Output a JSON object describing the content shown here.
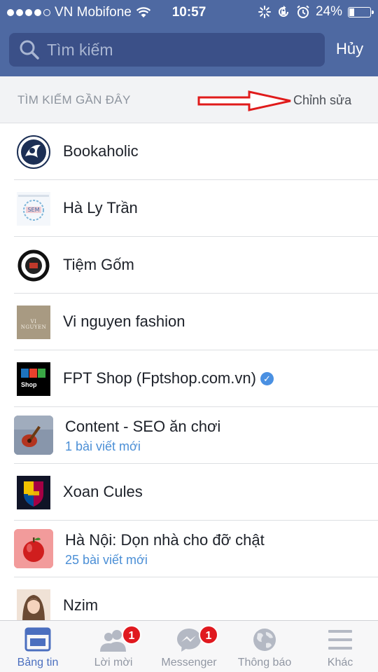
{
  "status_bar": {
    "carrier": "VN Mobifone",
    "time": "10:57",
    "battery": "24%"
  },
  "search": {
    "placeholder": "Tìm kiếm",
    "cancel_label": "Hủy"
  },
  "recent_header": {
    "title": "TÌM KIẾM GẦN ĐÂY",
    "edit_label": "Chỉnh sửa"
  },
  "recent_items": [
    {
      "name": "Bookaholic"
    },
    {
      "name": "Hà Ly Trần"
    },
    {
      "name": "Tiệm Gốm"
    },
    {
      "name": "Vi nguyen fashion",
      "avatar_text": "VI NGUYEN"
    },
    {
      "name": "FPT Shop (Fptshop.com.vn)",
      "verified": true,
      "avatar_text": "FPT",
      "avatar_sub": "Shop"
    },
    {
      "name": "Content - SEO ăn chơi",
      "subtitle": "1 bài viết mới"
    },
    {
      "name": "Xoan Cules"
    },
    {
      "name": "Hà Nội: Dọn nhà cho đỡ chật",
      "subtitle": "25 bài viết mới"
    },
    {
      "name": "Nzim"
    }
  ],
  "tabs": [
    {
      "label": "Bảng tin",
      "icon": "news-feed-icon",
      "active": true
    },
    {
      "label": "Lời mời",
      "icon": "friend-requests-icon",
      "badge": "1"
    },
    {
      "label": "Messenger",
      "icon": "messenger-icon",
      "badge": "1"
    },
    {
      "label": "Thông báo",
      "icon": "globe-icon"
    },
    {
      "label": "Khác",
      "icon": "menu-icon"
    }
  ],
  "colors": {
    "header_blue": "#4e69a2",
    "link_blue": "#4b8fd6",
    "badge_red": "#e0191f",
    "annotation_arrow": "#e01b1b"
  }
}
